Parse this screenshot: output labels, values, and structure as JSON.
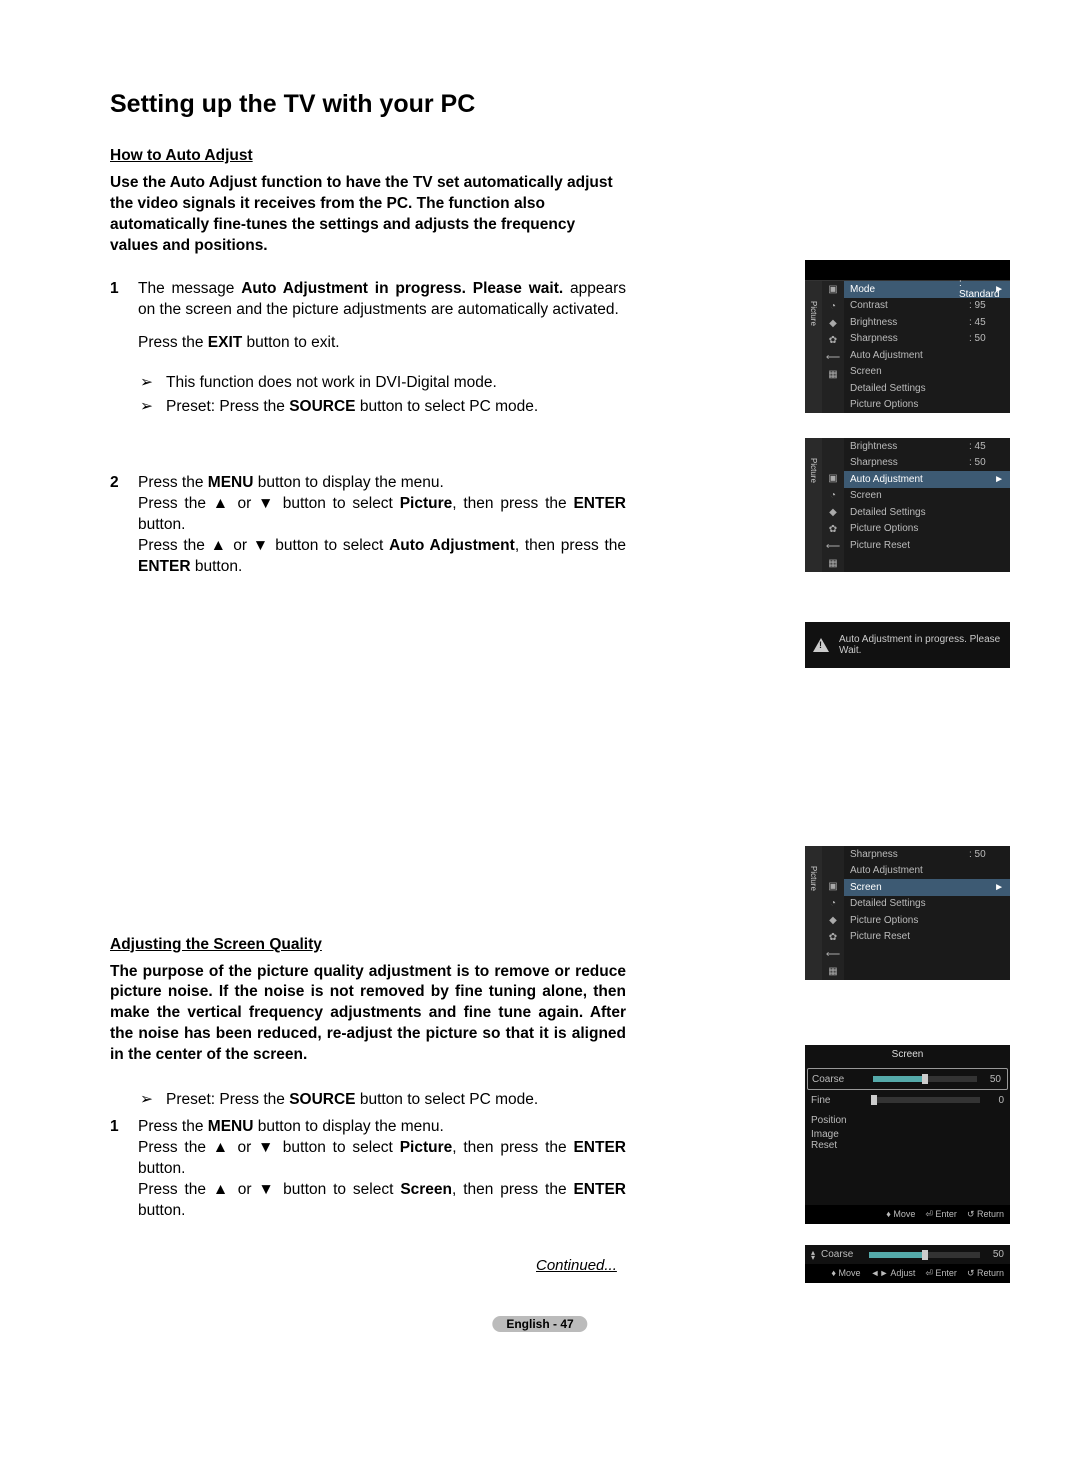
{
  "title": "Setting up the TV with your PC",
  "section1": {
    "heading": "How to Auto Adjust",
    "intro": "Use the Auto Adjust function to have the TV set automatically adjust the video signals it receives from the PC. The function also automatically fine-tunes the settings and adjusts the frequency values and positions.",
    "step1_num": "1",
    "step1_p1a": "The message ",
    "step1_p1b": "Auto Adjustment in progress. Please wait.",
    "step1_p1c": " appears on the screen and the picture adjustments are automatically activated.",
    "step1_p2a": "Press the ",
    "step1_p2b": "EXIT",
    "step1_p2c": " button to exit.",
    "note1": "This function does not work in DVI-Digital mode.",
    "note2a": "Preset: Press the ",
    "note2b": "SOURCE",
    "note2c": " button to select PC mode.",
    "step2_num": "2",
    "step2_p1a": "Press the ",
    "step2_p1b": "MENU",
    "step2_p1c": " button to display the menu.",
    "step2_p2a": "Press the ▲ or ▼ button to select ",
    "step2_p2b": "Picture",
    "step2_p2c": ", then press the ",
    "step2_p2d": "ENTER",
    "step2_p2e": " button.",
    "step2_p3a": "Press the ▲ or ▼ button to select ",
    "step2_p3b": "Auto Adjustment",
    "step2_p3c": ", then press the ",
    "step2_p3d": "ENTER",
    "step2_p3e": " button."
  },
  "section2": {
    "heading": "Adjusting the Screen Quality",
    "intro": "The purpose of the picture quality adjustment is to remove or reduce picture noise. If the noise is not removed by fine tuning alone, then make the vertical frequency adjustments and fine tune again. After the noise has been reduced, re-adjust the picture so that it is aligned in the center of the screen.",
    "note1a": "Preset: Press the ",
    "note1b": "SOURCE",
    "note1c": " button to select PC mode.",
    "step1_num": "1",
    "step1_p1a": "Press the ",
    "step1_p1b": "MENU",
    "step1_p1c": " button to display the menu.",
    "step1_p2a": "Press the ▲ or ▼ button to select ",
    "step1_p2b": "Picture",
    "step1_p2c": ", then press the ",
    "step1_p2d": "ENTER",
    "step1_p2e": " button.",
    "step1_p3a": "Press the ▲ or ▼ button to select ",
    "step1_p3b": "Screen",
    "step1_p3c": ", then press the ",
    "step1_p3d": "ENTER",
    "step1_p3e": " button."
  },
  "osd1": {
    "side": "Picture",
    "items": [
      {
        "label": "Mode",
        "val": ": Standard",
        "sel": true,
        "arrow": "►"
      },
      {
        "label": "Contrast",
        "val": ": 95"
      },
      {
        "label": "Brightness",
        "val": ": 45"
      },
      {
        "label": "Sharpness",
        "val": ": 50"
      },
      {
        "label": "Auto Adjustment"
      },
      {
        "label": "Screen"
      },
      {
        "label": "Detailed Settings"
      },
      {
        "label": "Picture Options"
      }
    ]
  },
  "osd2": {
    "side": "Picture",
    "items": [
      {
        "label": "Brightness",
        "val": ": 45"
      },
      {
        "label": "Sharpness",
        "val": ": 50"
      },
      {
        "label": "Auto Adjustment",
        "sel": true,
        "arrow": "►"
      },
      {
        "label": "Screen"
      },
      {
        "label": "Detailed Settings"
      },
      {
        "label": "Picture Options"
      },
      {
        "label": "Picture Reset"
      }
    ]
  },
  "warn": "Auto Adjustment in progress. Please Wait.",
  "osd3": {
    "side": "Picture",
    "items": [
      {
        "label": "Sharpness",
        "val": ": 50"
      },
      {
        "label": "Auto Adjustment"
      },
      {
        "label": "Screen",
        "sel": true,
        "arrow": "►"
      },
      {
        "label": "Detailed Settings"
      },
      {
        "label": "Picture Options"
      },
      {
        "label": "Picture Reset"
      }
    ]
  },
  "screen_panel": {
    "title": "Screen",
    "rows": [
      {
        "label": "Coarse",
        "val": "50",
        "pct": "50%",
        "selected": true
      },
      {
        "label": "Fine",
        "val": "0",
        "pct": "2%"
      },
      {
        "label": "Position"
      },
      {
        "label": "Image Reset"
      }
    ],
    "footer": [
      "♦ Move",
      "⏎ Enter",
      "↺ Return"
    ]
  },
  "coarse_panel": {
    "label": "Coarse",
    "val": "50",
    "pct": "50%",
    "footer": [
      "♦ Move",
      "◄► Adjust",
      "⏎ Enter",
      "↺ Return"
    ]
  },
  "continued": "Continued...",
  "pagefoot": "English - 47"
}
